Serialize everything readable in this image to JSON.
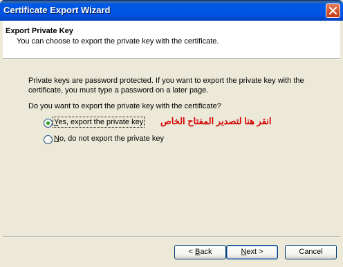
{
  "window": {
    "title": "Certificate Export Wizard"
  },
  "header": {
    "title": "Export Private Key",
    "subtitle": "You can choose to export the private key with the certificate."
  },
  "body": {
    "info_line1": "Private keys are password protected. If you want to export the private key with the",
    "info_line2": "certificate, you must type a password on a later page.",
    "question": "Do you want to export the private key with the certificate?"
  },
  "options": [
    {
      "label_accel": "Y",
      "label_rest": "es, export the private key",
      "selected": true
    },
    {
      "label_accel": "N",
      "label_rest": "o, do not export the private key",
      "selected": false
    }
  ],
  "annotation": {
    "text": "انقر هنا لتصدير المفتاح الخاص",
    "color": "#d40000"
  },
  "buttons": {
    "back": {
      "pre": "< ",
      "accel": "B",
      "rest": "ack"
    },
    "next": {
      "accel": "N",
      "rest": "ext >"
    },
    "cancel": {
      "label": "Cancel"
    }
  }
}
